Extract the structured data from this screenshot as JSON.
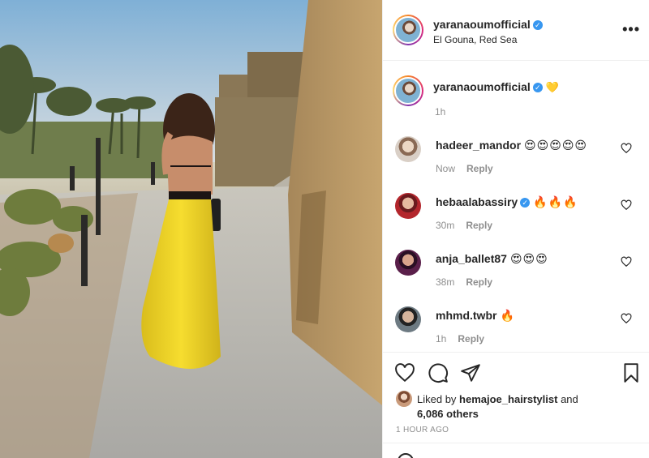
{
  "post": {
    "username": "yaranaoumofficial",
    "location": "El Gouna, Red Sea",
    "more_label": "•••"
  },
  "caption": {
    "username": "yaranaoumofficial",
    "text": "💛",
    "time": "1h"
  },
  "comments": [
    {
      "username": "hadeer_mandor",
      "text": "😍😍😍😍😍",
      "time": "Now",
      "reply": "Reply",
      "avatar_color": "#c9b8a8"
    },
    {
      "username": "hebaalabassiry",
      "text": "🔥🔥🔥",
      "time": "30m",
      "reply": "Reply",
      "verified": true,
      "avatar_color": "#b3262c"
    },
    {
      "username": "anja_ballet87",
      "text": "😍😍😍",
      "time": "38m",
      "reply": "Reply",
      "avatar_color": "#5a1f4a"
    },
    {
      "username": "mhmd.twbr",
      "text": "🔥",
      "time": "1h",
      "reply": "Reply",
      "avatar_color": "#4a5a66"
    }
  ],
  "likes": {
    "prefix": "Liked by",
    "user": "hemajoe_hairstylist",
    "and": "and",
    "others": "6,086 others"
  },
  "timestamp": "1 HOUR AGO",
  "colors": {
    "accent": "#3897f0",
    "secondary_text": "#8e8e8e",
    "skirt": "#f2d52a"
  }
}
